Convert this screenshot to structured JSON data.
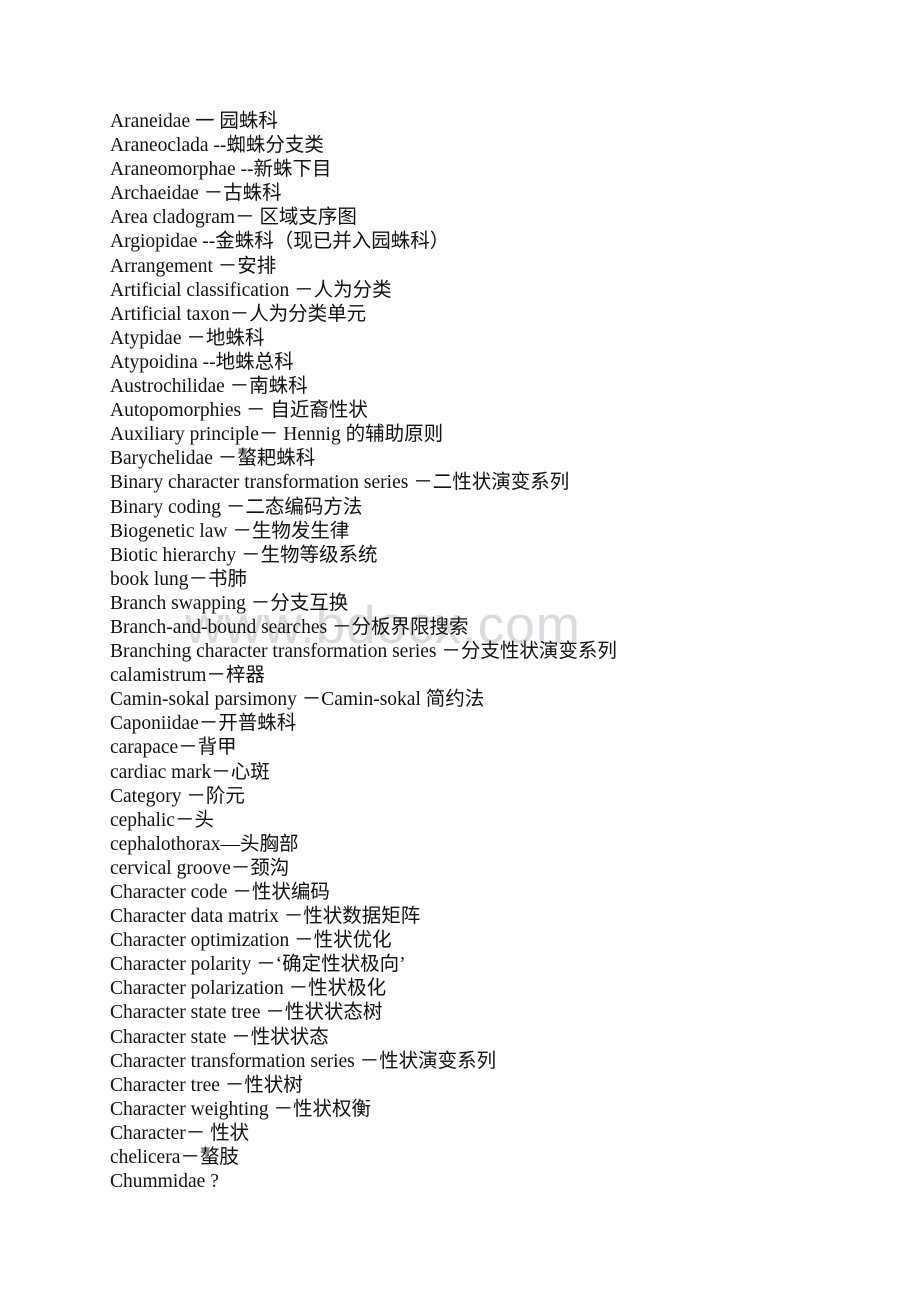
{
  "document": {
    "type": "glossary-page",
    "language": "en-zh",
    "page_background": "#ffffff",
    "text_color": "#111111"
  },
  "watermark": {
    "text": "www.bdocx.com",
    "color": "#dcdade"
  },
  "glossary": {
    "entries": [
      {
        "text": "Araneidae 一 园蛛科"
      },
      {
        "text": "Araneoclada --蜘蛛分支类"
      },
      {
        "text": "Araneomorphae --新蛛下目"
      },
      {
        "text": "Archaeidae －古蛛科"
      },
      {
        "text": "Area cladogram－ 区域支序图"
      },
      {
        "text": "Argiopidae --金蛛科（现已并入园蛛科）"
      },
      {
        "text": "Arrangement －安排"
      },
      {
        "text": "Artificial classification －人为分类"
      },
      {
        "text": "Artificial taxon－人为分类单元"
      },
      {
        "text": "Atypidae －地蛛科"
      },
      {
        "text": "Atypoidina --地蛛总科"
      },
      {
        "text": "Austrochilidae －南蛛科"
      },
      {
        "text": "Autopomorphies － 自近裔性状"
      },
      {
        "text": "Auxiliary principle－ Hennig 的辅助原则"
      },
      {
        "text": "Barychelidae －螯耙蛛科"
      },
      {
        "text": "Binary character transformation series －二性状演变系列"
      },
      {
        "text": "Binary coding －二态编码方法"
      },
      {
        "text": "Biogenetic law －生物发生律"
      },
      {
        "text": "Biotic hierarchy －生物等级系统"
      },
      {
        "text": "book lung－书肺"
      },
      {
        "text": "Branch swapping －分支互换"
      },
      {
        "text": "Branch-and-bound searches －分板界限搜索"
      },
      {
        "text": "Branching character transformation series －分支性状演变系列"
      },
      {
        "text": "calamistrum－梓器"
      },
      {
        "text": "Camin-sokal parsimony －Camin-sokal 简约法"
      },
      {
        "text": "Caponiidae－开普蛛科"
      },
      {
        "text": "carapace－背甲"
      },
      {
        "text": "cardiac mark－心斑"
      },
      {
        "text": "Category －阶元"
      },
      {
        "text": "cephalic－头"
      },
      {
        "text": "cephalothorax—头胸部"
      },
      {
        "text": "cervical groove－颈沟"
      },
      {
        "text": "Character code －性状编码"
      },
      {
        "text": "Character data matrix －性状数据矩阵"
      },
      {
        "text": "Character optimization －性状优化"
      },
      {
        "text": "Character polarity －‘确定性状极向’"
      },
      {
        "text": "Character polarization －性状极化"
      },
      {
        "text": "Character state tree －性状状态树"
      },
      {
        "text": "Character state －性状状态"
      },
      {
        "text": "Character transformation series －性状演变系列"
      },
      {
        "text": "Character tree －性状树"
      },
      {
        "text": "Character weighting －性状权衡"
      },
      {
        "text": "Character－ 性状"
      },
      {
        "text": "chelicera－螯肢"
      },
      {
        "text": "Chummidae ?"
      }
    ]
  }
}
